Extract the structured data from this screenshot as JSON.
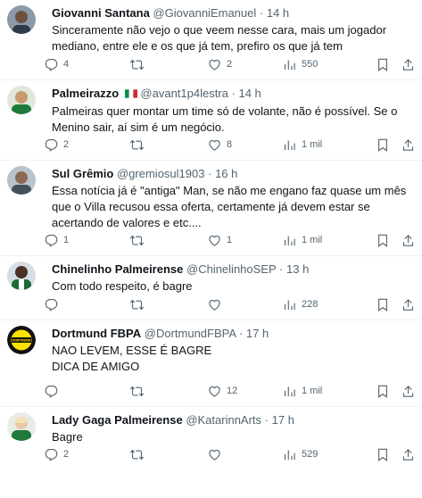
{
  "tweets": [
    {
      "name": "Giovanni Santana",
      "handle": "@GiovanniEmanuel",
      "separator": "·",
      "time": "14 h",
      "text": "Sinceramente não vejo o que veem nesse cara, mais um jogador mediano, entre ele e os que já tem, prefiro os que já tem",
      "replies": "4",
      "retweets": "",
      "likes": "2",
      "views": "550"
    },
    {
      "name": "Palmeirazzo",
      "flag": "italy-flag-emoji",
      "handle": "@avant1p4lestra",
      "separator": "·",
      "time": "14 h",
      "text": "Palmeiras quer montar um time só de volante, não é possível. Se o Menino sair, aí sim é um negócio.",
      "replies": "2",
      "retweets": "",
      "likes": "8",
      "views": "1 mil"
    },
    {
      "name": "Sul Grêmio",
      "handle": "@gremiosul1903",
      "separator": "·",
      "time": "16 h",
      "text": "Essa notícia já é \"antiga\" Man, se não me engano faz quase um mês que o Villa recusou essa oferta, certamente já devem estar se acertando de valores e etc....",
      "replies": "1",
      "retweets": "",
      "likes": "1",
      "views": "1 mil"
    },
    {
      "name": "Chinelinho Palmeirense",
      "handle": "@ChinelinhoSEP",
      "separator": "·",
      "time": "13 h",
      "text": "Com todo respeito, é bagre",
      "replies": "",
      "retweets": "",
      "likes": "",
      "views": "228"
    },
    {
      "name": "Dortmund FBPA",
      "handle": "@DortmundFBPA",
      "separator": "·",
      "time": "17 h",
      "text": "NAO LEVEM, ESSE É BAGRE\nDICA DE AMIGO",
      "replies": "",
      "retweets": "",
      "likes": "12",
      "views": "1 mil",
      "avatar_text": "DORTMUND"
    },
    {
      "name": "Lady Gaga Palmeirense",
      "handle": "@KatarinnArts",
      "separator": "·",
      "time": "17 h",
      "text": "Bagre",
      "replies": "2",
      "retweets": "",
      "likes": "",
      "views": "529"
    }
  ],
  "colors": {
    "text": "#0f1419",
    "secondary": "#536471",
    "divider": "#eff3f4"
  }
}
